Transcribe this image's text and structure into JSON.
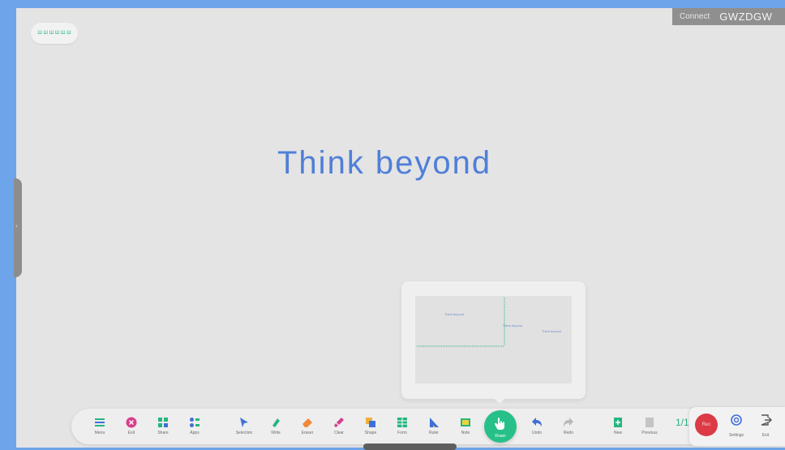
{
  "board": {
    "chip_label": "Ш Ш Ш Ш Ш Ш",
    "connect_label": "Connect",
    "connect_code": "GWZDGW",
    "handwriting": "Think beyond",
    "preview_texts": [
      "Think beyond",
      "Think beyond",
      "Think beyond"
    ],
    "handle_glyph": "›"
  },
  "toolbar": {
    "left_tools": [
      {
        "label": "Menu",
        "icon": "menu-icon",
        "color": "#27b57f"
      },
      {
        "label": "Exit",
        "icon": "close-circle-icon",
        "color": "#d63f8c"
      },
      {
        "label": "Share",
        "icon": "grid-icon",
        "color": "#27b57f"
      },
      {
        "label": "Apps",
        "icon": "apps-icon",
        "color": "#3f6fd8"
      }
    ],
    "main_tools": [
      {
        "label": "Selection",
        "icon": "cursor-icon",
        "color": "#3f6fd8"
      },
      {
        "label": "Write",
        "icon": "pen-icon",
        "color": "#27b57f"
      },
      {
        "label": "Eraser",
        "icon": "eraser-icon",
        "color": "#f08a3a"
      },
      {
        "label": "Clear",
        "icon": "brush-icon",
        "color": "#d63f8c"
      },
      {
        "label": "Shape",
        "icon": "shape-icon",
        "color": "#3f6fd8"
      },
      {
        "label": "Form",
        "icon": "table-icon",
        "color": "#27b57f"
      },
      {
        "label": "Ruler",
        "icon": "ruler-icon",
        "color": "#3f6fd8"
      },
      {
        "label": "Note",
        "icon": "note-icon",
        "color": "#27b57f"
      }
    ],
    "pointer_label": "Roam",
    "history_tools": [
      {
        "label": "Undo",
        "icon": "undo-icon",
        "color": "#3f6fd8"
      },
      {
        "label": "Redo",
        "icon": "redo-icon",
        "color": "#b8b8b8"
      }
    ],
    "page_tools": [
      {
        "label": "New",
        "icon": "add-page-icon",
        "color": "#27b57f"
      },
      {
        "label": "Previous",
        "icon": "page-icon",
        "color": "#b8b8b8"
      }
    ],
    "page_number": "1/1"
  },
  "right_panel": {
    "record_label": "Rec",
    "settings_label": "Settings",
    "exit_label": "Exit"
  }
}
